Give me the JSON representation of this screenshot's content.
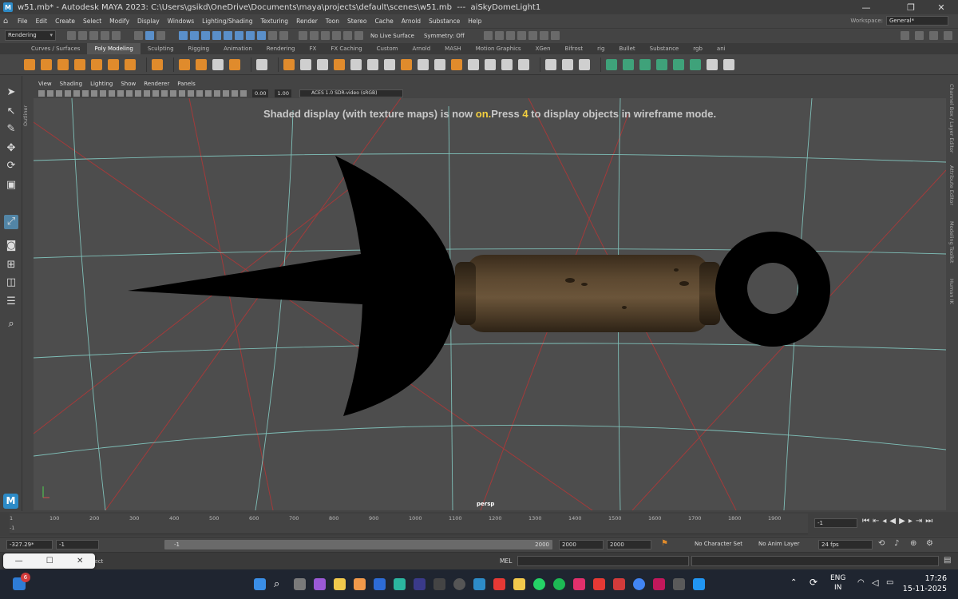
{
  "window": {
    "title": "w51.mb* - Autodesk MAYA 2023: C:\\Users\\gsikd\\OneDrive\\Documents\\maya\\projects\\default\\scenes\\w51.mb  ---  aiSkyDomeLight1",
    "minimize": "—",
    "maximize": "❐",
    "close": "✕"
  },
  "menubar": {
    "items": [
      "File",
      "Edit",
      "Create",
      "Select",
      "Modify",
      "Display",
      "Windows",
      "Lighting/Shading",
      "Texturing",
      "Render",
      "Toon",
      "Stereo",
      "Cache",
      "Arnold",
      "Substance",
      "Help"
    ],
    "workspace_label": "Workspace:",
    "workspace_value": "General*"
  },
  "statusline": {
    "mode": "Rendering",
    "live_surface": "No Live Surface",
    "symmetry": "Symmetry: Off"
  },
  "shelf": {
    "tabs": [
      "Curves / Surfaces",
      "Poly Modeling",
      "Sculpting",
      "Rigging",
      "Animation",
      "Rendering",
      "FX",
      "FX Caching",
      "Custom",
      "Arnold",
      "MASH",
      "Motion Graphics",
      "XGen",
      "Bifrost",
      "rig",
      "Bullet",
      "Substance",
      "rgb",
      "ani"
    ],
    "active_tab": "Poly Modeling"
  },
  "sidebar": {
    "outliner_label": "Outliner",
    "right_labels": [
      "Channel Box / Layer Editor",
      "Attribute Editor",
      "Modeling Toolkit",
      "Human IK"
    ]
  },
  "panel": {
    "menus": [
      "View",
      "Shading",
      "Lighting",
      "Show",
      "Renderer",
      "Panels"
    ],
    "exposure": "0.00",
    "gamma": "1.00",
    "color_space": "ACES 1.0 SDR-video (sRGB)",
    "camera": "persp"
  },
  "hud": {
    "prefix": "Shaded display (with texture maps) is now ",
    "state": "on.",
    "middle": "Press ",
    "key": "4",
    "suffix": " to display objects in wireframe mode."
  },
  "timeline": {
    "ticks": [
      "1",
      "100",
      "200",
      "300",
      "400",
      "500",
      "600",
      "700",
      "800",
      "900",
      "1000",
      "1100",
      "1200",
      "1300",
      "1400",
      "1500",
      "1600",
      "1700",
      "1800",
      "1900"
    ],
    "current_frame": "-1",
    "frame_field": "-1"
  },
  "range": {
    "left_value": "-327.29*",
    "start": "-1",
    "slider_start": "-1",
    "slider_end": "2000",
    "end": "2000",
    "end2": "2000",
    "character_set": "No Character Set",
    "anim_layer": "No Anim Layer",
    "fps": "24 fps"
  },
  "cmdline": {
    "label": "MEL",
    "partial_text": "bject"
  },
  "taskbar": {
    "notification_count": "6",
    "lang_top": "ENG",
    "lang_bottom": "IN",
    "time": "17:26",
    "date": "15-11-2025"
  },
  "colors": {
    "accent": "#5285a6",
    "hud_highlight": "#f4d03f",
    "grid_cyan": "#7fbfb8",
    "grid_red": "#a33a3a",
    "wood": "#4a3a26"
  }
}
